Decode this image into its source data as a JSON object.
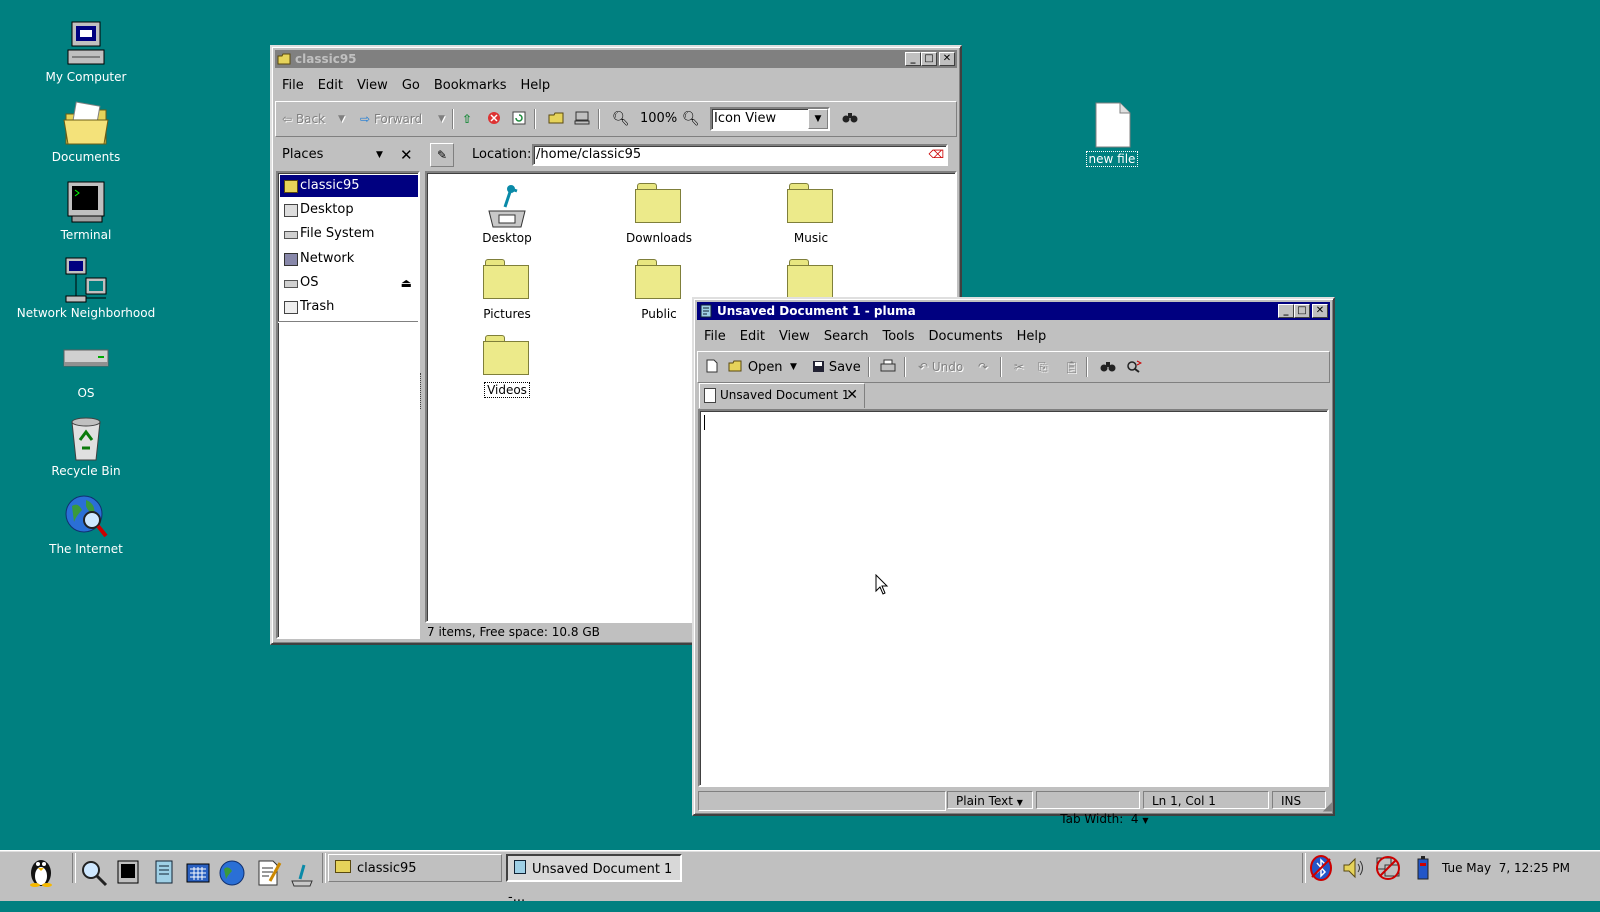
{
  "desktop": {
    "icons": [
      {
        "label": "My Computer",
        "icon": "computer-icon"
      },
      {
        "label": "Documents",
        "icon": "documents-folder-icon"
      },
      {
        "label": "Terminal",
        "icon": "terminal-icon"
      },
      {
        "label": "Network Neighborhood",
        "icon": "network-icon"
      },
      {
        "label": "OS",
        "icon": "drive-icon"
      },
      {
        "label": "Recycle Bin",
        "icon": "recycle-bin-icon"
      },
      {
        "label": "The Internet",
        "icon": "internet-globe-icon"
      },
      {
        "label": "new file",
        "icon": "blank-file-icon"
      }
    ]
  },
  "file_manager": {
    "title": "classic95",
    "menu": [
      "File",
      "Edit",
      "View",
      "Go",
      "Bookmarks",
      "Help"
    ],
    "toolbar": {
      "back": "Back",
      "forward": "Forward",
      "zoom": "100%",
      "view_mode": "Icon View"
    },
    "places_label": "Places",
    "location_label": "Location:",
    "location_value": "/home/classic95",
    "places": [
      "classic95",
      "Desktop",
      "File System",
      "Network",
      "OS",
      "Trash"
    ],
    "items": [
      "Desktop",
      "Downloads",
      "Music",
      "Pictures",
      "Public",
      "",
      "Videos"
    ],
    "status": "7 items, Free space: 10.8 GB"
  },
  "editor": {
    "title": "Unsaved Document 1 - pluma",
    "menu": [
      "File",
      "Edit",
      "View",
      "Search",
      "Tools",
      "Documents",
      "Help"
    ],
    "toolbar": {
      "open": "Open",
      "save": "Save",
      "undo": "Undo"
    },
    "tab_label": "Unsaved Document 1",
    "content": "",
    "status": {
      "language": "Plain Text",
      "tab_width": "Tab Width:  4",
      "position": "Ln 1, Col 1",
      "mode": "INS"
    }
  },
  "taskbar": {
    "tasks": [
      "classic95",
      "Unsaved Document 1 -..."
    ],
    "clock": "Tue May  7, 12:25 PM"
  },
  "colors": {
    "desktop": "#008080",
    "active_title": "#000080",
    "inactive_title": "#808080",
    "face": "#c0c0c0"
  }
}
